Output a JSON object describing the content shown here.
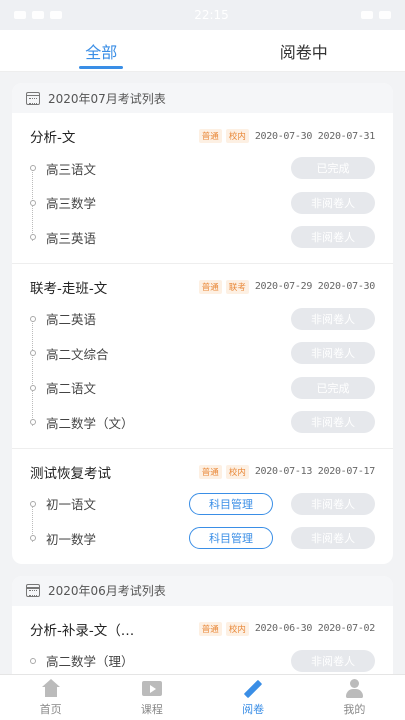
{
  "statusbar": {
    "time": "22:15"
  },
  "tabs": [
    {
      "label": "全部",
      "active": true
    },
    {
      "label": "阅卷中",
      "active": false
    }
  ],
  "groups": [
    {
      "header": "2020年07月考试列表",
      "exams": [
        {
          "title": "分析-文",
          "tags": [
            "普通",
            "校内"
          ],
          "start": "2020-07-30",
          "end": "2020-07-31",
          "subjects": [
            {
              "name": "高三语文",
              "status": "已完成"
            },
            {
              "name": "高三数学",
              "status": "非阅卷人"
            },
            {
              "name": "高三英语",
              "status": "非阅卷人"
            }
          ]
        },
        {
          "title": "联考-走班-文",
          "tags": [
            "普通",
            "联考"
          ],
          "start": "2020-07-29",
          "end": "2020-07-30",
          "subjects": [
            {
              "name": "高二英语",
              "status": "非阅卷人"
            },
            {
              "name": "高二文综合",
              "status": "非阅卷人"
            },
            {
              "name": "高二语文",
              "status": "已完成"
            },
            {
              "name": "高二数学（文）",
              "status": "非阅卷人"
            }
          ]
        },
        {
          "title": "测试恢复考试",
          "tags": [
            "普通",
            "校内"
          ],
          "start": "2020-07-13",
          "end": "2020-07-17",
          "subjects": [
            {
              "name": "初一语文",
              "manage": "科目管理",
              "status": "非阅卷人"
            },
            {
              "name": "初一数学",
              "manage": "科目管理",
              "status": "非阅卷人"
            }
          ]
        }
      ]
    },
    {
      "header": "2020年06月考试列表",
      "exams": [
        {
          "title": "分析-补录-文（…",
          "tags": [
            "普通",
            "校内"
          ],
          "start": "2020-06-30",
          "end": "2020-07-02",
          "subjects": [
            {
              "name": "高二数学（理）",
              "status": "非阅卷人"
            }
          ]
        }
      ]
    }
  ],
  "bottom_nav": [
    {
      "label": "首页",
      "icon": "home-icon",
      "active": false
    },
    {
      "label": "课程",
      "icon": "course-icon",
      "active": false
    },
    {
      "label": "阅卷",
      "icon": "grade-icon",
      "active": true
    },
    {
      "label": "我的",
      "icon": "mine-icon",
      "active": false
    }
  ]
}
